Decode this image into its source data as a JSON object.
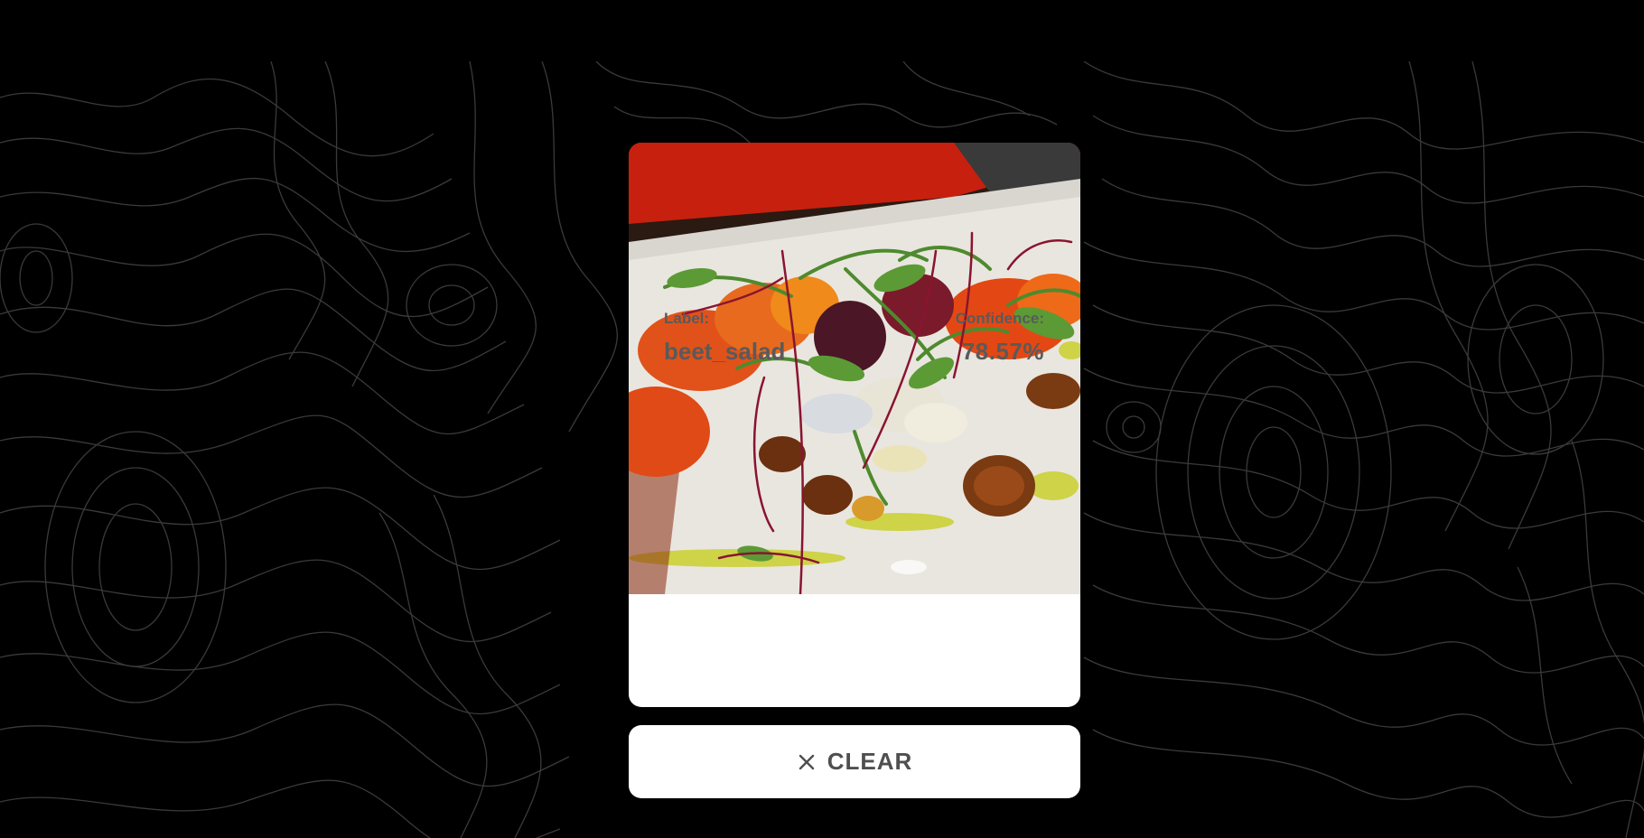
{
  "result": {
    "label_caption": "Label:",
    "label_value": "beet_salad",
    "confidence_caption": "Confidence:",
    "confidence_value": "78.57%"
  },
  "actions": {
    "clear_label": "CLEAR",
    "clear_icon": "close-icon"
  },
  "colors": {
    "background": "#000000",
    "contour_lines": "#3a3a3a",
    "card": "#ffffff",
    "text": "#5a5a5a"
  },
  "photo": {
    "subject": "food-photo-icon"
  }
}
